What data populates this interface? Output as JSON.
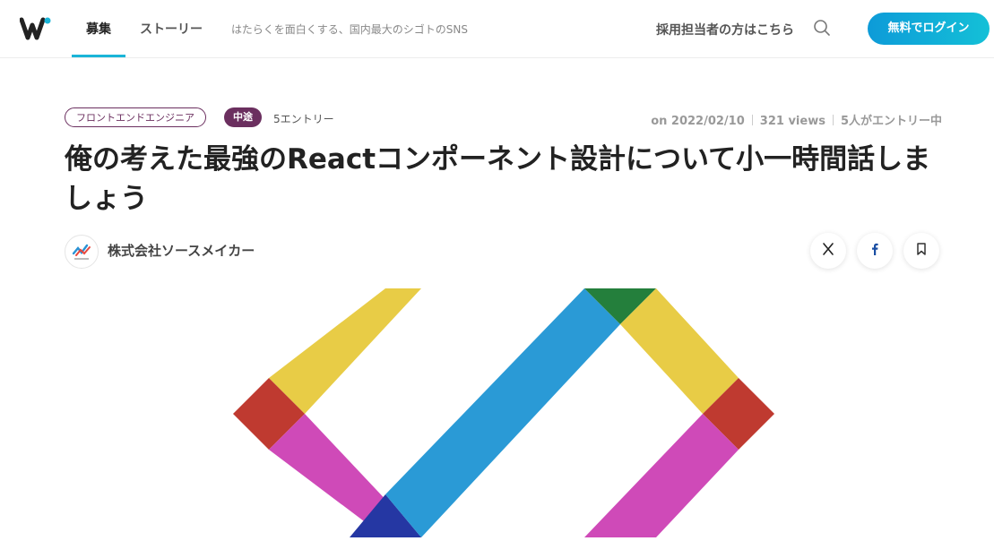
{
  "header": {
    "logo_name": "wantedly-logo",
    "nav": {
      "recruit": "募集",
      "story": "ストーリー"
    },
    "tagline": "はたらくを面白くする、国内最大のシゴトのSNS",
    "recruiter_link": "採用担当者の方はこちら",
    "login_button": "無料でログイン",
    "accent_color": "#1ab5d8"
  },
  "post": {
    "occupation_tag": "フロントエンドエンジニア",
    "type_tag": "中途",
    "entries": "5エントリー",
    "date": "on 2022/02/10",
    "views": "321 views",
    "entry_status": "5人がエントリー中",
    "title": "俺の考えた最強のReactコンポーネント設計について小一時間話しましょう",
    "company": "株式会社ソースメイカー",
    "tag_color": "#6b2f5f"
  },
  "actions": {
    "share_x_icon": "x-icon",
    "share_facebook_icon": "facebook-icon",
    "bookmark_icon": "bookmark-icon"
  }
}
